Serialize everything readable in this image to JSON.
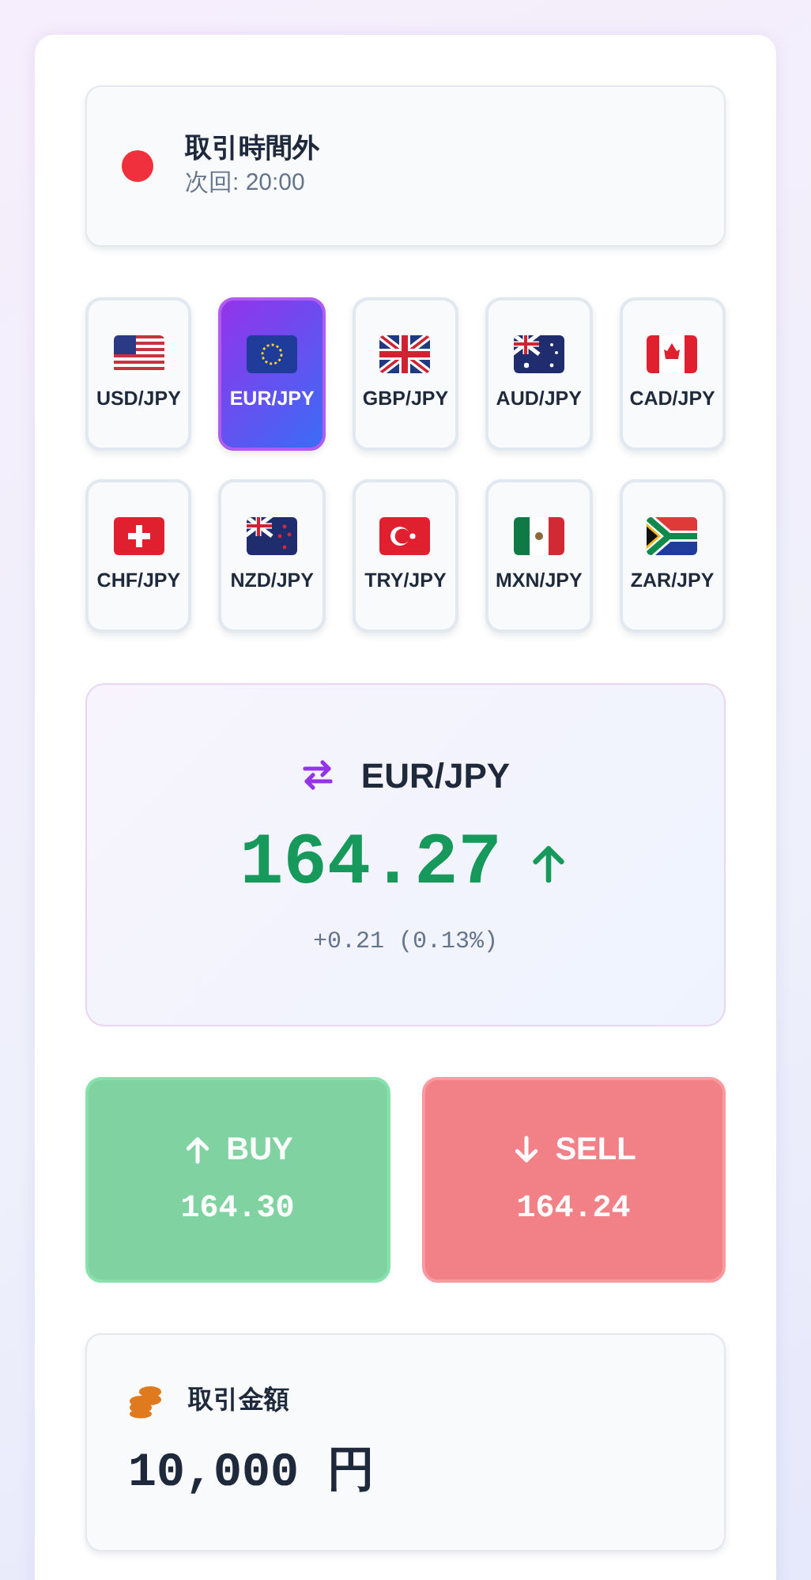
{
  "market_status": {
    "open": false,
    "title": "取引時間外",
    "next": "次回: 20:00"
  },
  "pairs": [
    {
      "label": "USD/JPY",
      "selected": false
    },
    {
      "label": "EUR/JPY",
      "selected": true
    },
    {
      "label": "GBP/JPY",
      "selected": false
    },
    {
      "label": "AUD/JPY",
      "selected": false
    },
    {
      "label": "CAD/JPY",
      "selected": false
    },
    {
      "label": "CHF/JPY",
      "selected": false
    },
    {
      "label": "NZD/JPY",
      "selected": false
    },
    {
      "label": "TRY/JPY",
      "selected": false
    },
    {
      "label": "MXN/JPY",
      "selected": false
    },
    {
      "label": "ZAR/JPY",
      "selected": false
    }
  ],
  "quote": {
    "pair": "EUR/JPY",
    "price": "164.27",
    "rising": true,
    "change": "+0.21 (0.13%)"
  },
  "actions": [
    {
      "kind": "buy",
      "label": "BUY",
      "price": "164.30"
    },
    {
      "kind": "sell",
      "label": "SELL",
      "price": "164.24"
    }
  ],
  "amount": {
    "label": "取引金額",
    "value": "10,000 円"
  }
}
